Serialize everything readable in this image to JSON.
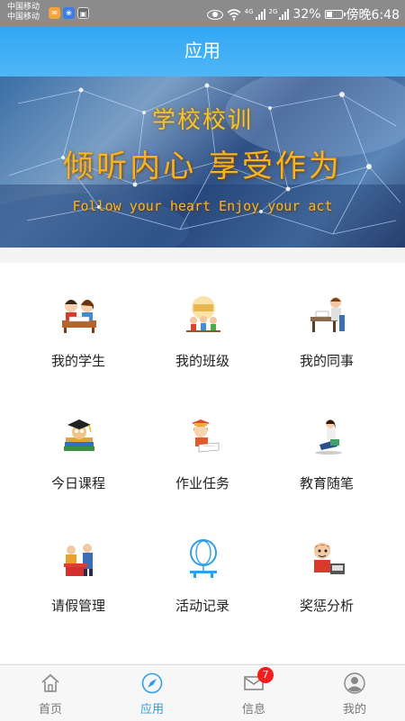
{
  "status_bar": {
    "carrier_1": "中国移动",
    "carrier_2": "中国移动",
    "notif_icons": [
      "mail-icon",
      "baidu-icon",
      "app-icon"
    ],
    "network_1": "4G",
    "network_2": "2G",
    "battery": "32%",
    "time": "傍晚6:48"
  },
  "header": {
    "title": "应用"
  },
  "banner": {
    "heading": "学校校训",
    "motto": "倾听内心 享受作为",
    "motto_en": "Follow your heart  Enjoy your act"
  },
  "apps": [
    {
      "label": "我的学生",
      "icon": "students-icon"
    },
    {
      "label": "我的班级",
      "icon": "class-icon"
    },
    {
      "label": "我的同事",
      "icon": "colleagues-icon"
    },
    {
      "label": "今日课程",
      "icon": "courses-icon"
    },
    {
      "label": "作业任务",
      "icon": "homework-icon"
    },
    {
      "label": "教育随笔",
      "icon": "essay-icon"
    },
    {
      "label": "请假管理",
      "icon": "leave-icon"
    },
    {
      "label": "活动记录",
      "icon": "activity-icon"
    },
    {
      "label": "奖惩分析",
      "icon": "reward-icon"
    }
  ],
  "bottom_nav": {
    "tabs": [
      {
        "label": "首页",
        "icon": "home-icon"
      },
      {
        "label": "应用",
        "icon": "compass-icon",
        "active": true
      },
      {
        "label": "信息",
        "icon": "mail-icon",
        "badge": "7"
      },
      {
        "label": "我的",
        "icon": "profile-icon"
      }
    ]
  },
  "colors": {
    "accent": "#2f9fe6",
    "header": "#3aaaf4",
    "badge": "#f31e1e"
  }
}
